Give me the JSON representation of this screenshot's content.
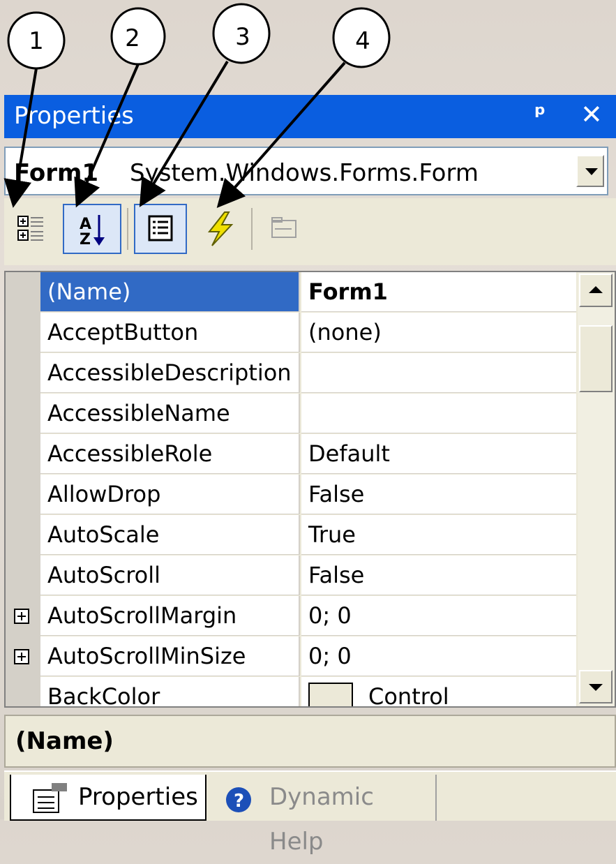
{
  "callouts": [
    "1",
    "2",
    "3",
    "4"
  ],
  "titlebar": {
    "title": "Properties",
    "pin_icon": "pin-icon",
    "close_icon": "close-icon"
  },
  "object_selector": {
    "name": "Form1",
    "type": "System.Windows.Forms.Form"
  },
  "toolbar": {
    "buttons": [
      {
        "icon": "categorized-icon",
        "active": false
      },
      {
        "icon": "alphabetical-icon",
        "active": true
      },
      {
        "icon": "properties-icon",
        "active": true
      },
      {
        "icon": "events-icon",
        "active": false
      },
      {
        "icon": "property-pages-icon",
        "active": false,
        "disabled": true
      }
    ]
  },
  "grid": {
    "rows": [
      {
        "name": "(Name)",
        "value": "Form1",
        "selected": true,
        "bold_value": true
      },
      {
        "name": "AcceptButton",
        "value": "(none)"
      },
      {
        "name": "AccessibleDescription",
        "value": ""
      },
      {
        "name": "AccessibleName",
        "value": ""
      },
      {
        "name": "AccessibleRole",
        "value": "Default"
      },
      {
        "name": "AllowDrop",
        "value": "False"
      },
      {
        "name": "AutoScale",
        "value": "True"
      },
      {
        "name": "AutoScroll",
        "value": "False"
      },
      {
        "name": "AutoScrollMargin",
        "value": "0; 0",
        "expandable": true
      },
      {
        "name": "AutoScrollMinSize",
        "value": "0; 0",
        "expandable": true
      },
      {
        "name": "BackColor",
        "value": "Control"
      }
    ]
  },
  "description": {
    "title": "(Name)"
  },
  "tabs": [
    {
      "label": "Properties",
      "icon": "properties-page-icon",
      "active": true
    },
    {
      "label": "Dynamic Help",
      "icon": "help-icon",
      "active": false
    }
  ],
  "colors": {
    "titlebar": "#0a5ee0",
    "selection": "#316ac5",
    "panel": "#ece9d8"
  }
}
